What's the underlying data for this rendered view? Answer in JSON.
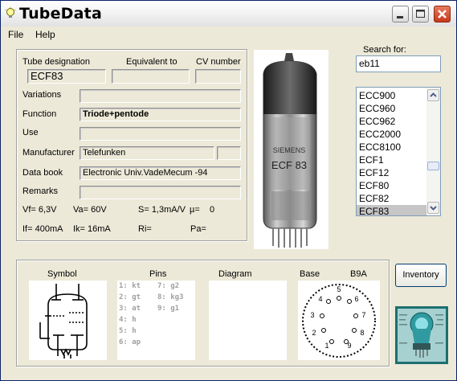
{
  "window": {
    "title": "TubeData"
  },
  "menu": [
    {
      "label": "File"
    },
    {
      "label": "Help"
    }
  ],
  "details": {
    "tube_designation_label": "Tube designation",
    "equivalent_label": "Equivalent to",
    "cv_label": "CV number",
    "tube_designation": "ECF83",
    "equivalent": "",
    "cv_number": "",
    "variations_label": "Variations",
    "variations": "",
    "function_label": "Function",
    "function": "Triode+pentode",
    "use_label": "Use",
    "use": "",
    "manufacturer_label": "Manufacturer",
    "manufacturer": "Telefunken",
    "manufacturer_extra": "",
    "databook_label": "Data book",
    "databook": "Electronic Univ.VadeMecum -94",
    "remarks_label": "Remarks",
    "remarks": ""
  },
  "specs": {
    "vf": "Vf= 6,3V",
    "va": "Va= 60V",
    "s": "S= 1,3mA/V",
    "mu": "µ=",
    "mu_val": "0",
    "if": "If= 400mA",
    "ik": "Ik= 16mA",
    "ri": "Ri=",
    "pa": "Pa="
  },
  "photo": {
    "print_line1": "SIEMENS",
    "print_line2": "ECF 83"
  },
  "search": {
    "label": "Search for:",
    "value": "eb11",
    "list": [
      "ECC900",
      "ECC960",
      "ECC962",
      "ECC2000",
      "ECC8100",
      "ECF1",
      "ECF12",
      "ECF80",
      "ECF82",
      "ECF83"
    ],
    "selected_index": 9
  },
  "bottom": {
    "symbol_label": "Symbol",
    "pins_label": "Pins",
    "diagram_label": "Diagram",
    "base_label": "Base",
    "base_type": "B9A",
    "pins_col1": [
      "1: kt",
      "2: gt",
      "3: at",
      "4: h",
      "5: h",
      "6: ap"
    ],
    "pins_col2": [
      "7: g2",
      "8: kg3",
      "9: g1"
    ],
    "base_pins": [
      "1",
      "2",
      "3",
      "4",
      "5",
      "6",
      "7",
      "8",
      "9"
    ]
  },
  "inventory_button": "Inventory"
}
